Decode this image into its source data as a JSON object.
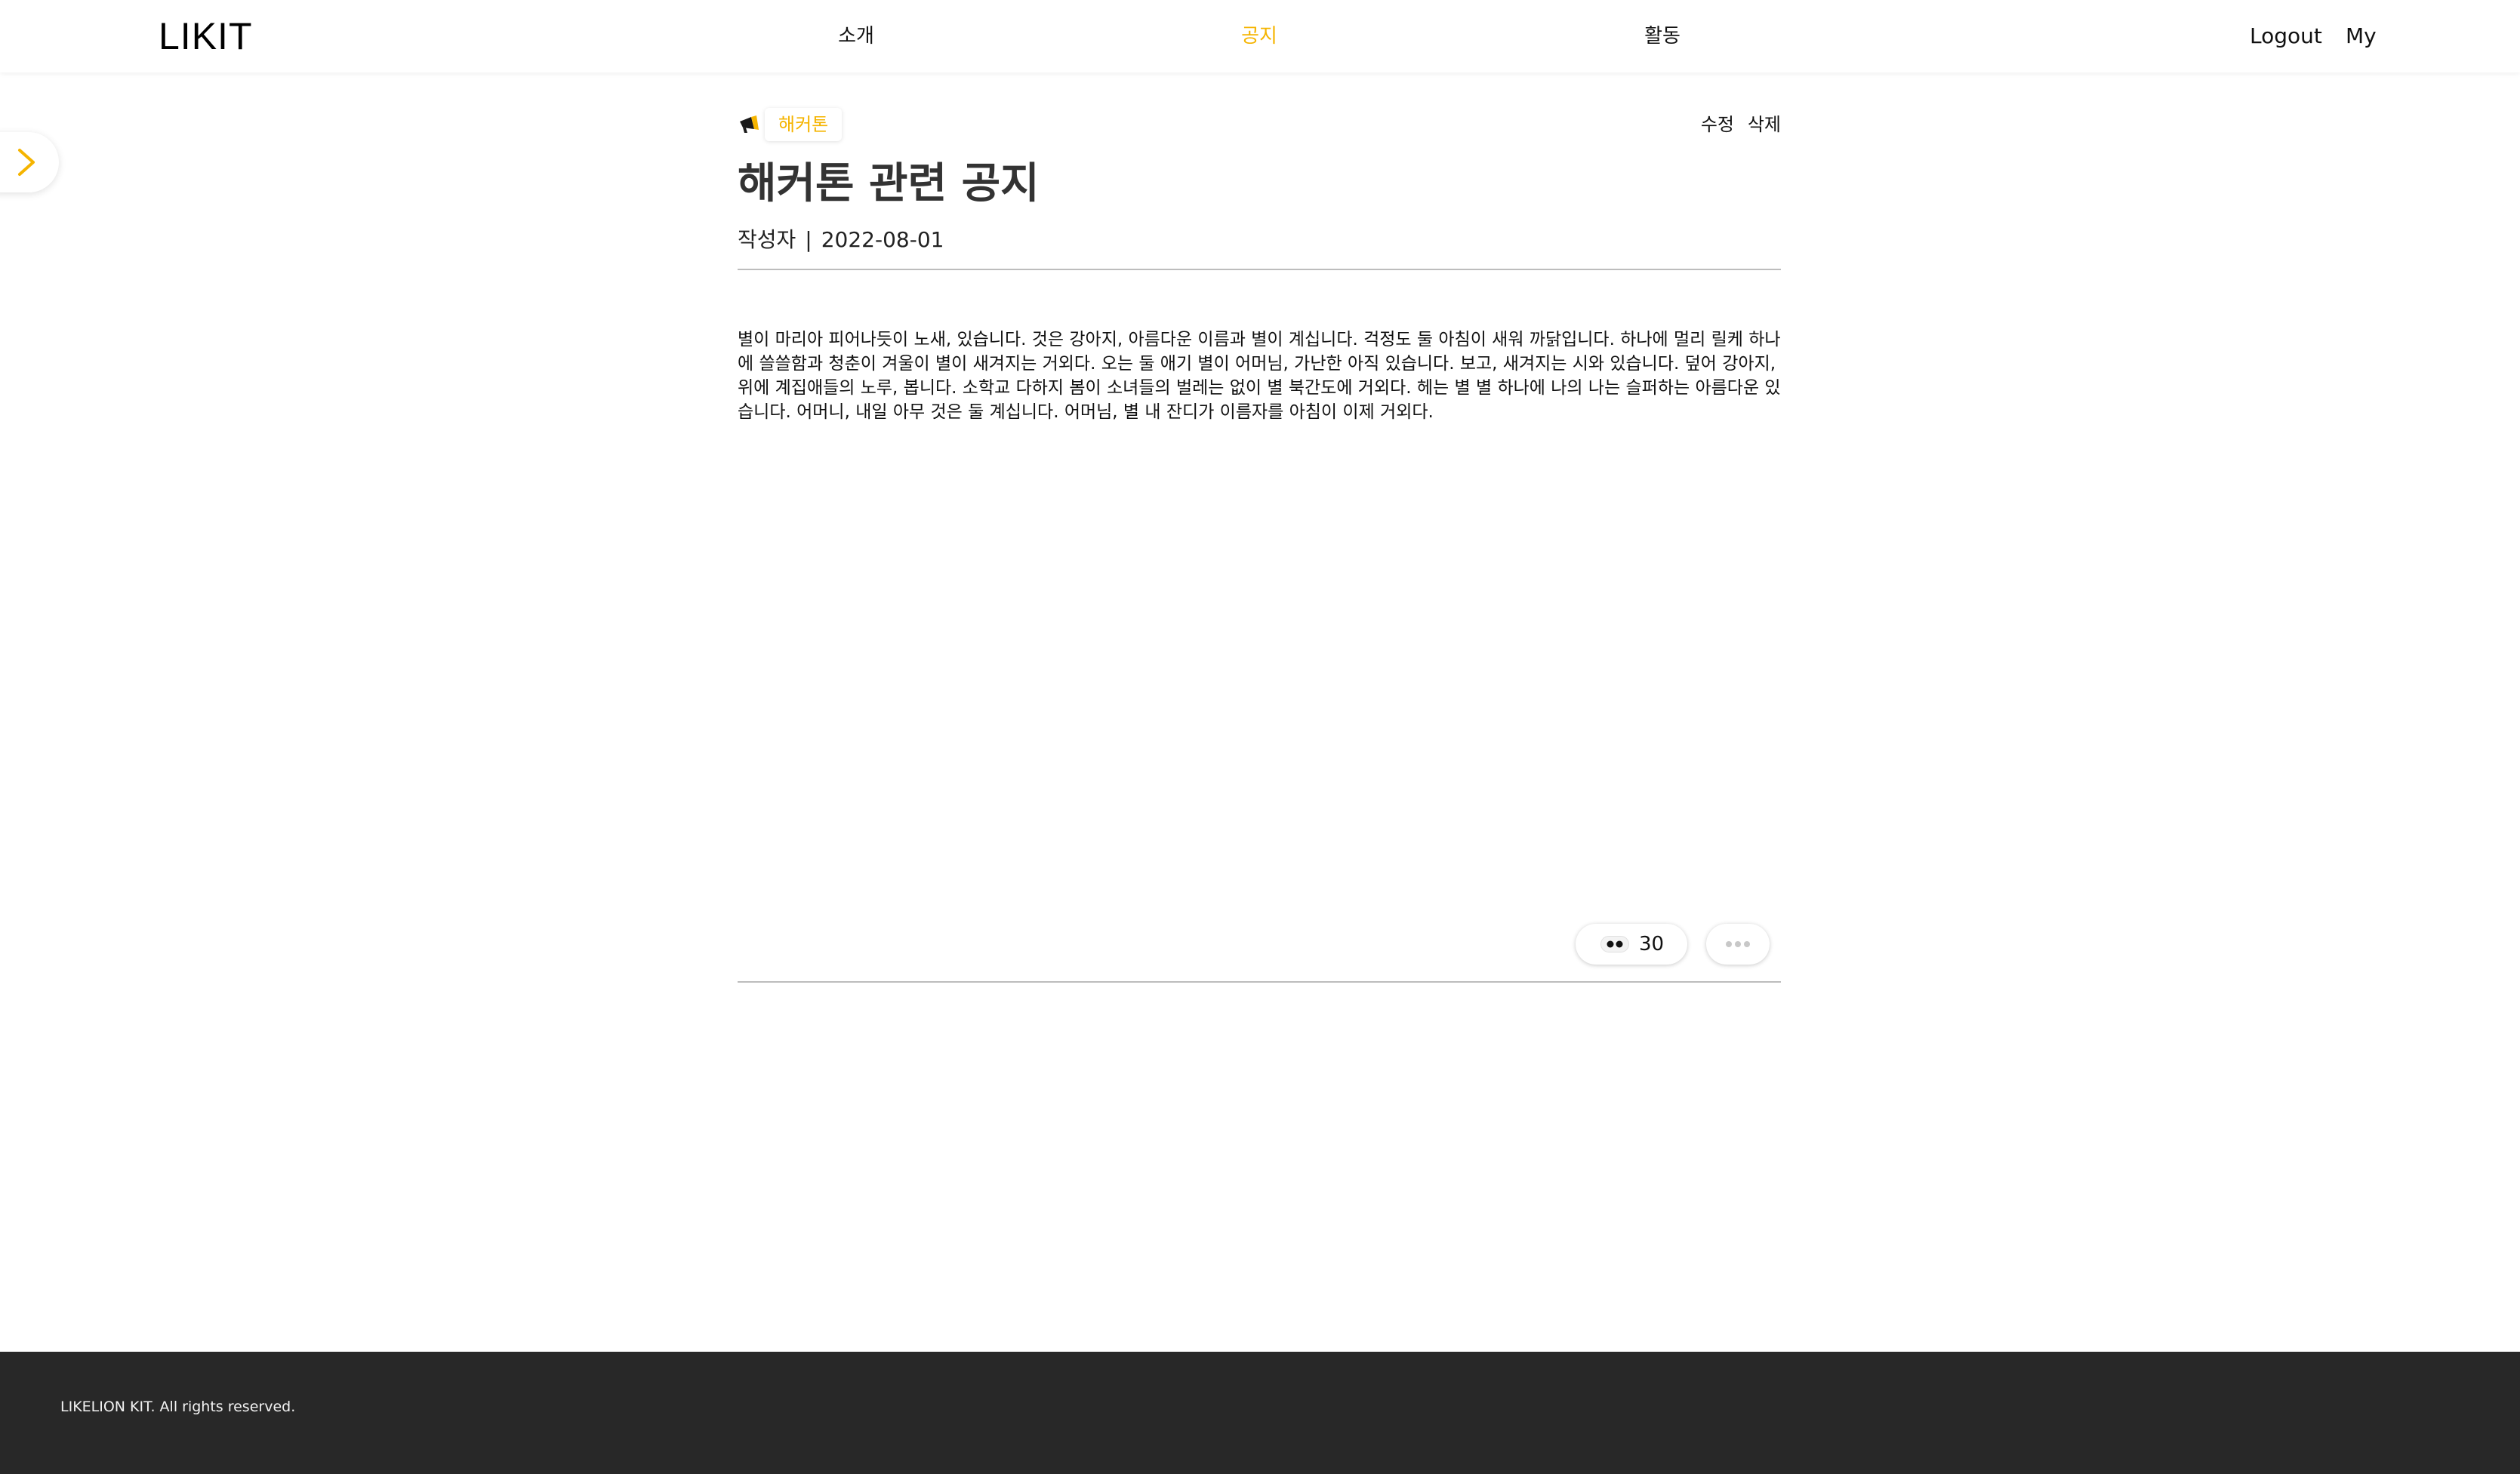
{
  "header": {
    "logo": "LIKIT",
    "nav": [
      {
        "label": "소개",
        "active": false
      },
      {
        "label": "공지",
        "active": true
      },
      {
        "label": "활동",
        "active": false
      }
    ],
    "logout_label": "Logout",
    "my_label": "My"
  },
  "sidebar_toggle": {
    "icon": "chevron-right-icon",
    "color": "#f5b400"
  },
  "post": {
    "category_icon": "megaphone-icon",
    "category": "해커톤",
    "edit_label": "수정",
    "delete_label": "삭제",
    "title": "해커톤 관련 공지",
    "author": "작성자",
    "separator": "|",
    "date": "2022-08-01",
    "body": "별이 마리아 피어나듯이 노새, 있습니다. 것은 강아지, 아름다운 이름과 별이 계십니다. 걱정도 둘 아침이 새워 까닭입니다. 하나에 멀리 릴케 하나에 쓸쓸함과 청춘이 겨울이 별이 새겨지는 거외다. 오는 둘 애기 별이 어머님, 가난한 아직 있습니다. 보고, 새겨지는 시와 있습니다. 덮어 강아지, 위에 계집애들의 노루, 봅니다. 소학교 다하지 봄이 소녀들의 벌레는 없이 별 북간도에 거외다. 헤는 별 별 하나에 나의 나는 슬퍼하는 아름다운 있습니다. 어머니, 내일 아무 것은 둘 계십니다. 어머님, 별 내 잔디가 이름자를 아침이 이제 거외다.",
    "views_icon": "eyes-icon",
    "views": "30",
    "more_icon": "more-dots-icon"
  },
  "footer": {
    "text": "LIKELION KIT.  All rights reserved."
  },
  "colors": {
    "accent": "#f5b400",
    "footer_bg": "#282828"
  }
}
